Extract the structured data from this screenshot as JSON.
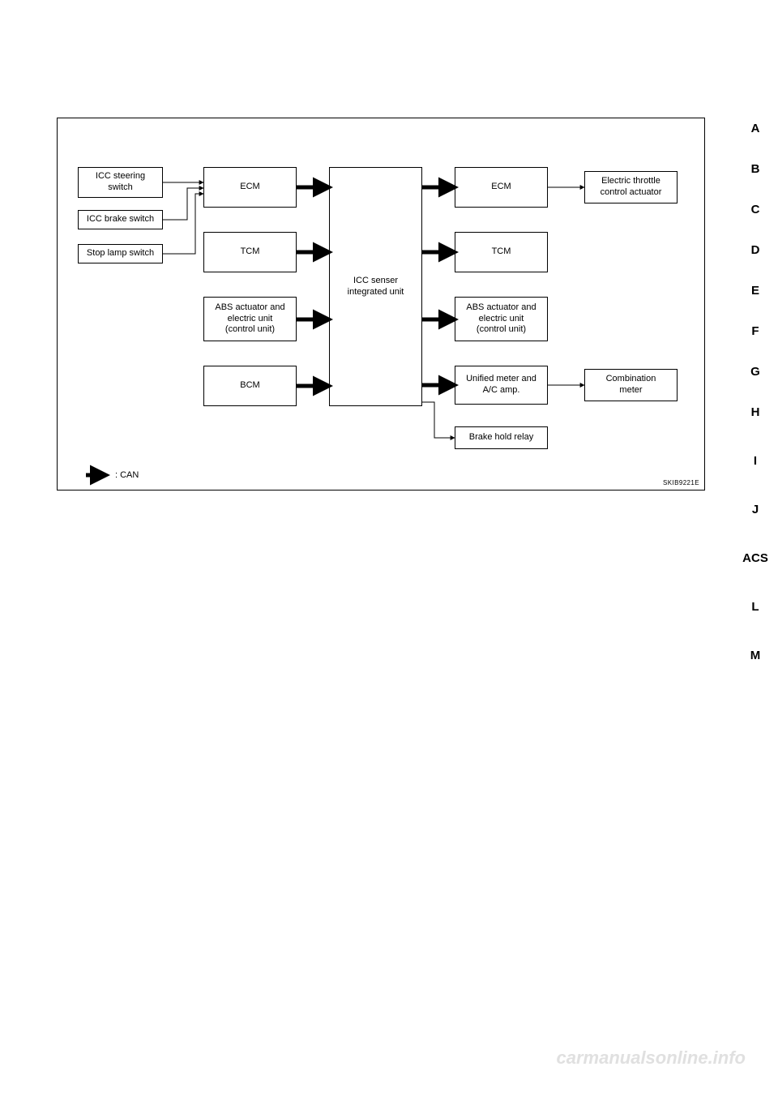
{
  "sidebar": {
    "items": [
      "A",
      "B",
      "C",
      "D",
      "E",
      "F",
      "G",
      "H",
      "I",
      "J",
      "ACS",
      "L",
      "M"
    ]
  },
  "diagram": {
    "inputs_left": {
      "icc_steering": "ICC steering\nswitch",
      "icc_brake": "ICC brake switch",
      "stop_lamp": "Stop lamp switch"
    },
    "col_in": {
      "ecm": "ECM",
      "tcm": "TCM",
      "abs": "ABS actuator and\nelectric unit\n(control unit)",
      "bcm": "BCM"
    },
    "center": "ICC senser\nintegrated unit",
    "col_out": {
      "ecm": "ECM",
      "tcm": "TCM",
      "abs": "ABS actuator and\nelectric unit\n(control unit)",
      "umac": "Unified meter and\nA/C amp.",
      "brake_hold": "Brake hold relay"
    },
    "outputs_right": {
      "etca": "Electric throttle\ncontrol actuator",
      "combo": "Combination\nmeter"
    },
    "legend": ": CAN",
    "code": "SKIB9221E"
  },
  "watermark": "carmanualsonline.info"
}
